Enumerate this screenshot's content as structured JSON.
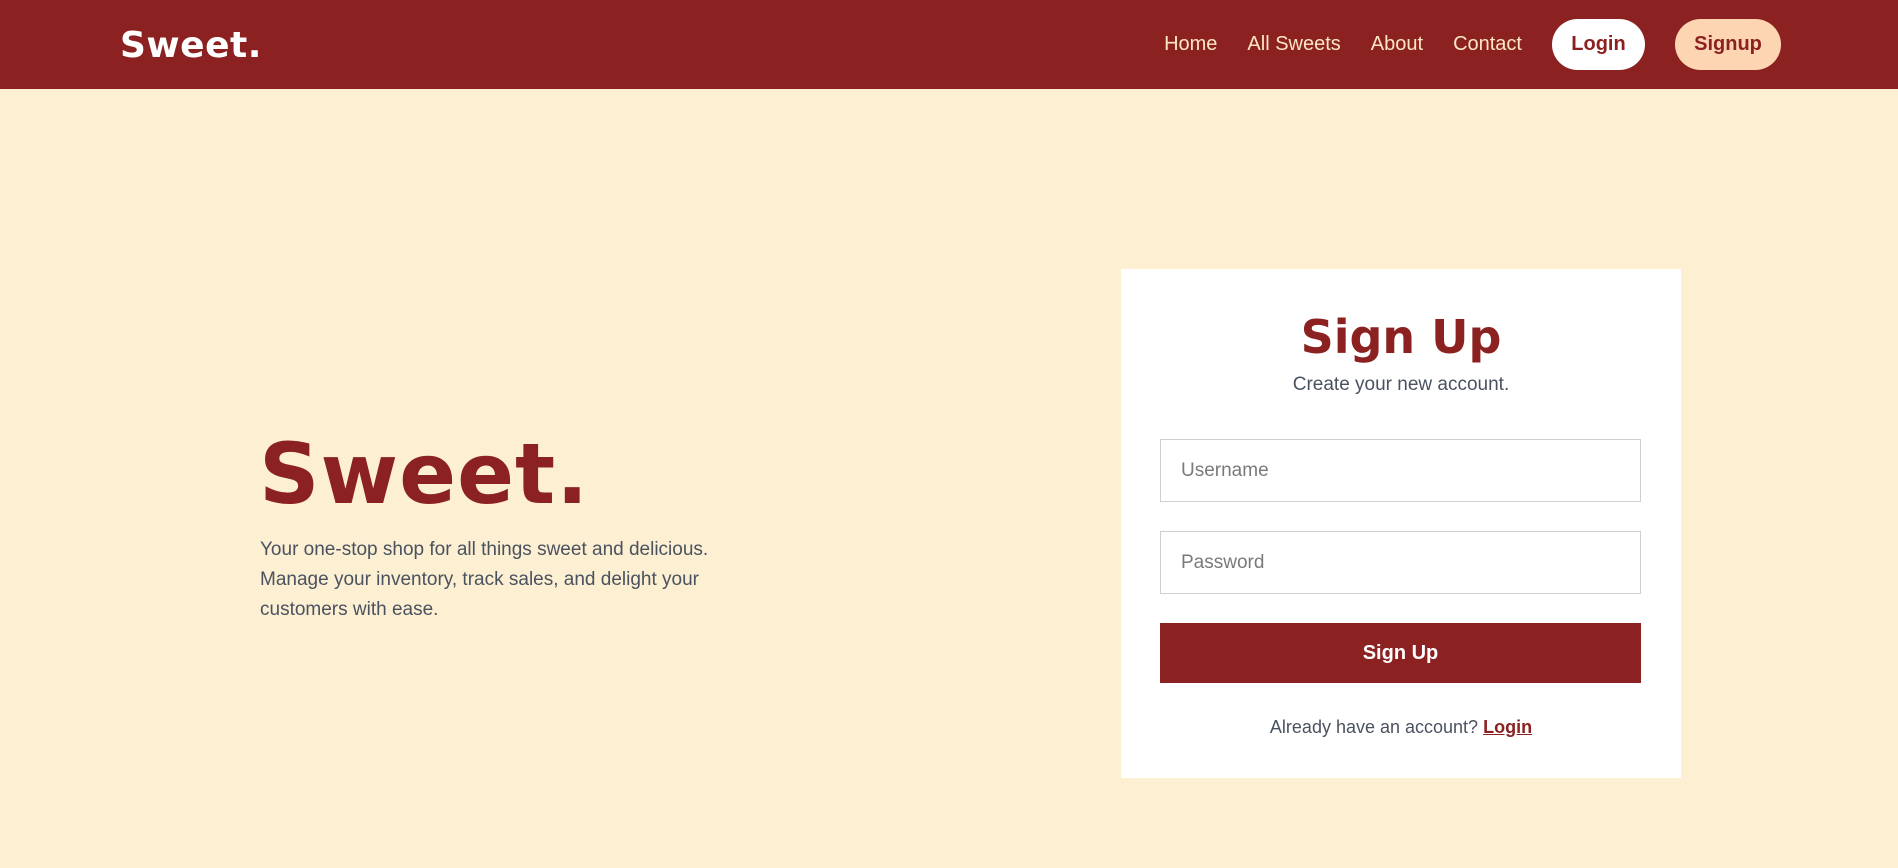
{
  "navbar": {
    "brand": "Sweet.",
    "links": [
      {
        "label": "Home"
      },
      {
        "label": "All Sweets"
      },
      {
        "label": "About"
      },
      {
        "label": "Contact"
      }
    ],
    "login_label": "Login",
    "signup_label": "Signup"
  },
  "hero": {
    "title": "Sweet.",
    "description": "Your one-stop shop for all things sweet and delicious. Manage your inventory, track sales, and delight your customers with ease."
  },
  "signup_form": {
    "title": "Sign Up",
    "subtitle": "Create your new account.",
    "username": {
      "placeholder": "Username",
      "value": ""
    },
    "password": {
      "placeholder": "Password",
      "value": ""
    },
    "submit_label": "Sign Up",
    "footer_text": "Already have an account?",
    "footer_link": "Login"
  },
  "colors": {
    "primary": "#8b2121",
    "background": "#fdefd2",
    "signup_button": "#fdd5b3",
    "card": "#ffffff",
    "body_text": "#4a5260"
  }
}
